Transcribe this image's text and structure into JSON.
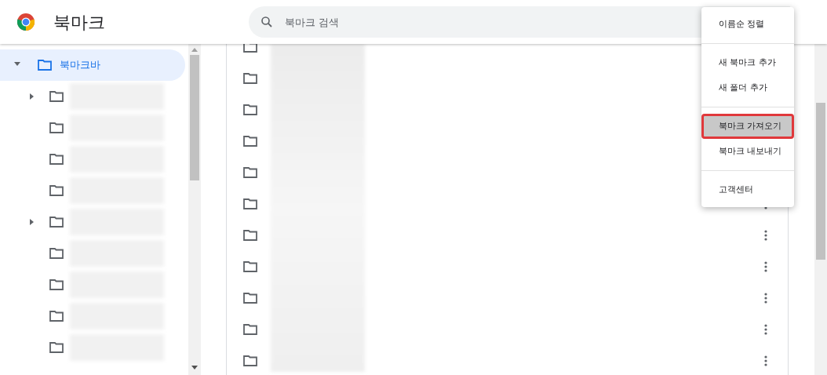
{
  "header": {
    "title": "북마크",
    "search": {
      "placeholder": "북마크 검색"
    }
  },
  "sidebar": {
    "items": [
      {
        "label": "북마크바",
        "selected": true,
        "expanded": true,
        "children": [
          {
            "kind": "expandable"
          },
          {
            "kind": "leaf"
          },
          {
            "kind": "leaf"
          },
          {
            "kind": "leaf"
          },
          {
            "kind": "expandable"
          },
          {
            "kind": "leaf"
          },
          {
            "kind": "leaf"
          },
          {
            "kind": "leaf"
          },
          {
            "kind": "leaf"
          }
        ]
      }
    ]
  },
  "list": {
    "rows": [
      {
        "kind": "folder"
      },
      {
        "kind": "folder"
      },
      {
        "kind": "folder"
      },
      {
        "kind": "folder"
      },
      {
        "kind": "folder"
      },
      {
        "kind": "folder"
      },
      {
        "kind": "folder"
      },
      {
        "kind": "folder"
      },
      {
        "kind": "folder"
      },
      {
        "kind": "folder"
      },
      {
        "kind": "folder"
      }
    ]
  },
  "menu": {
    "groups": [
      [
        {
          "label": "이름순 정렬",
          "highlighted": false
        }
      ],
      [
        {
          "label": "새 북마크 추가",
          "highlighted": false
        },
        {
          "label": "새 폴더 추가",
          "highlighted": false
        }
      ],
      [
        {
          "label": "북마크 가져오기",
          "highlighted": true
        },
        {
          "label": "북마크 내보내기",
          "highlighted": false
        }
      ],
      [
        {
          "label": "고객센터",
          "highlighted": false
        }
      ]
    ]
  }
}
